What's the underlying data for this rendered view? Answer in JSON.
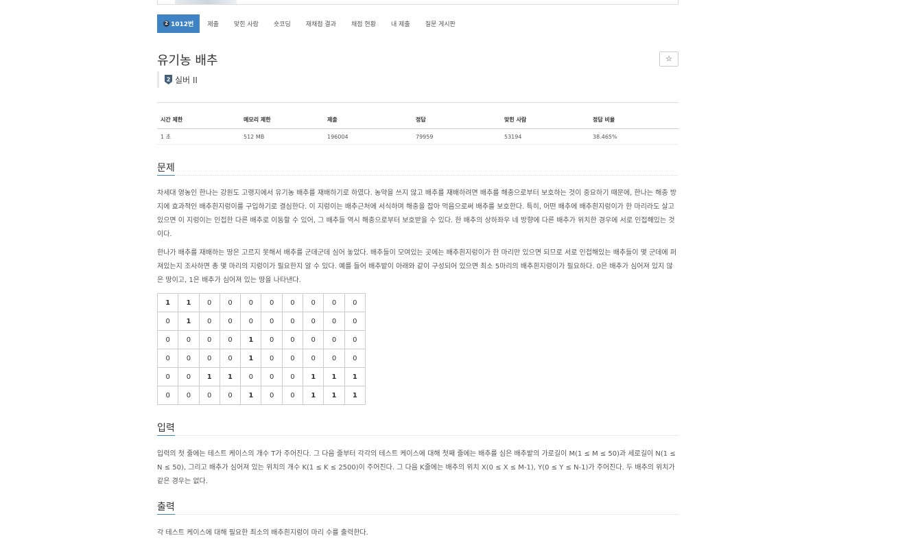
{
  "nav": {
    "problem_number": "1012번",
    "tier_badge": "2",
    "items": [
      "제출",
      "맞힌 사람",
      "숏코딩",
      "재채점 결과",
      "채점 현황",
      "내 제출",
      "질문 게시판"
    ]
  },
  "problem": {
    "title": "유기농 배추",
    "star_button": "☆",
    "tier_number": "2",
    "tier": "실버 II"
  },
  "info_table": {
    "headers": [
      "시간 제한",
      "메모리 제한",
      "제출",
      "정답",
      "맞힌 사람",
      "정답 비율"
    ],
    "values": [
      "1 초",
      "512 MB",
      "196004",
      "79959",
      "53194",
      "38.465%"
    ]
  },
  "sections": {
    "problem_heading": "문제",
    "problem_para1": "차세대 영농인 한나는 강원도 고랭지에서 유기농 배추를 재배하기로 하였다. 농약을 쓰지 않고 배추를 재배하려면 배추를 해충으로부터 보호하는 것이 중요하기 때문에, 한나는 해충 방지에 효과적인 배추흰지렁이를 구입하기로 결심한다. 이 지렁이는 배추근처에 서식하며 해충을 잡아 먹음으로써 배추를 보호한다. 특히, 어떤 배추에 배추흰지렁이가 한 마리라도 살고 있으면 이 지렁이는 인접한 다른 배추로 이동할 수 있어, 그 배추들 역시 해충으로부터 보호받을 수 있다. 한 배추의 상하좌우 네 방향에 다른 배추가 위치한 경우에 서로 인접해있는 것이다.",
    "problem_para2": "한나가 배추를 재배하는 땅은 고르지 못해서 배추를 군데군데 심어 놓았다. 배추들이 모여있는 곳에는 배추흰지렁이가 한 마리만 있으면 되므로 서로 인접해있는 배추들이 몇 군데에 퍼져있는지 조사하면 총 몇 마리의 지렁이가 필요한지 알 수 있다. 예를 들어 배추밭이 아래와 같이 구성되어 있으면 최소 5마리의 배추흰지렁이가 필요하다. 0은 배추가 심어져 있지 않은 땅이고, 1은 배추가 심어져 있는 땅을 나타낸다.",
    "input_heading": "입력",
    "input_para": "입력의 첫 줄에는 테스트 케이스의 개수 T가 주어진다. 그 다음 줄부터 각각의 테스트 케이스에 대해 첫째 줄에는 배추를 심은 배추밭의 가로길이 M(1 ≤ M ≤ 50)과 세로길이 N(1 ≤ N ≤ 50), 그리고 배추가 심어져 있는 위치의 개수 K(1 ≤ K ≤ 2500)이 주어진다. 그 다음 K줄에는 배추의 위치 X(0 ≤ X ≤ M-1), Y(0 ≤ Y ≤ N-1)가 주어진다. 두 배추의 위치가 같은 경우는 없다.",
    "output_heading": "출력",
    "output_para": "각 테스트 케이스에 대해 필요한 최소의 배추흰지렁이 마리 수를 출력한다."
  },
  "grid": [
    [
      "1",
      "1",
      "0",
      "0",
      "0",
      "0",
      "0",
      "0",
      "0",
      "0"
    ],
    [
      "0",
      "1",
      "0",
      "0",
      "0",
      "0",
      "0",
      "0",
      "0",
      "0"
    ],
    [
      "0",
      "0",
      "0",
      "0",
      "1",
      "0",
      "0",
      "0",
      "0",
      "0"
    ],
    [
      "0",
      "0",
      "0",
      "0",
      "1",
      "0",
      "0",
      "0",
      "0",
      "0"
    ],
    [
      "0",
      "0",
      "1",
      "1",
      "0",
      "0",
      "0",
      "1",
      "1",
      "1"
    ],
    [
      "0",
      "0",
      "0",
      "0",
      "1",
      "0",
      "0",
      "1",
      "1",
      "1"
    ]
  ]
}
